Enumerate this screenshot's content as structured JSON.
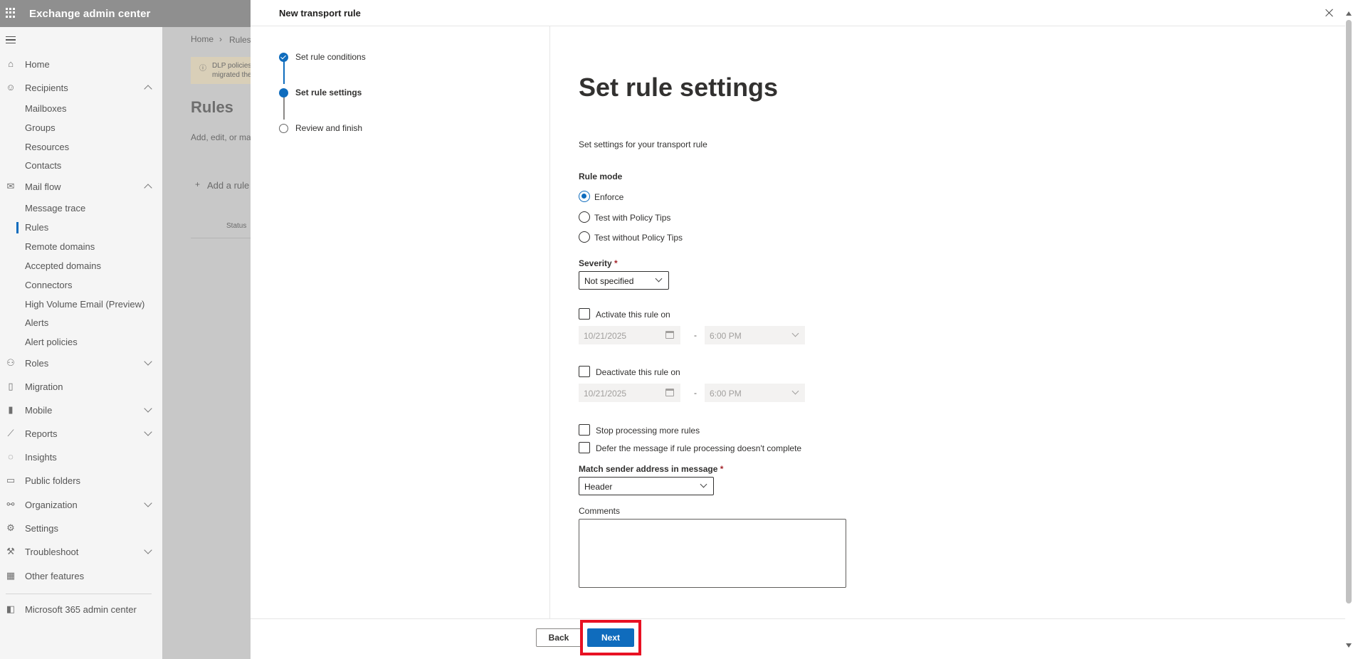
{
  "app": {
    "title": "Exchange admin center"
  },
  "nav": {
    "home": "Home",
    "recipients": "Recipients",
    "mailboxes": "Mailboxes",
    "groups": "Groups",
    "resources": "Resources",
    "contacts": "Contacts",
    "mail_flow": "Mail flow",
    "message_trace": "Message trace",
    "rules": "Rules",
    "remote_domains": "Remote domains",
    "accepted_domains": "Accepted domains",
    "connectors": "Connectors",
    "high_volume_email": "High Volume Email (Preview)",
    "alerts": "Alerts",
    "alert_policies": "Alert policies",
    "roles": "Roles",
    "migration": "Migration",
    "mobile": "Mobile",
    "reports": "Reports",
    "insights": "Insights",
    "public_folders": "Public folders",
    "organization": "Organization",
    "settings": "Settings",
    "troubleshoot": "Troubleshoot",
    "other_features": "Other features",
    "m365": "Microsoft 365 admin center"
  },
  "background": {
    "breadcrumb_home": "Home",
    "breadcrumb_rules": "Rules",
    "dlp_text_1": "DLP policies",
    "dlp_text_2": "migrated the",
    "page_title": "Rules",
    "page_desc": "Add, edit, or ma",
    "add_rule": "Add a rule",
    "col_status": "Status"
  },
  "panel": {
    "title": "New transport rule",
    "steps": [
      {
        "label": "Set rule conditions",
        "state": "done"
      },
      {
        "label": "Set rule settings",
        "state": "current"
      },
      {
        "label": "Review and finish",
        "state": "pending"
      }
    ],
    "heading": "Set rule settings",
    "subtitle": "Set settings for your transport rule",
    "rule_mode_label": "Rule mode",
    "rule_mode_options": [
      "Enforce",
      "Test with Policy Tips",
      "Test without Policy Tips"
    ],
    "rule_mode_selected": "Enforce",
    "severity_label": "Severity",
    "required_mark": "*",
    "severity_value": "Not specified",
    "activate_label": "Activate this rule on",
    "activate_date": "10/21/2025",
    "activate_time": "6:00 PM",
    "deactivate_label": "Deactivate this rule on",
    "deactivate_date": "10/21/2025",
    "deactivate_time": "6:00 PM",
    "dash": "-",
    "stop_processing": "Stop processing more rules",
    "defer_message": "Defer the message if rule processing doesn't complete",
    "match_sender_label": "Match sender address in message",
    "match_sender_value": "Header",
    "comments_label": "Comments",
    "comments_value": "",
    "back_button": "Back",
    "next_button": "Next"
  },
  "colors": {
    "accent": "#0f6cbd",
    "highlight": "#e81123",
    "topbar": "#8f8f8f"
  }
}
